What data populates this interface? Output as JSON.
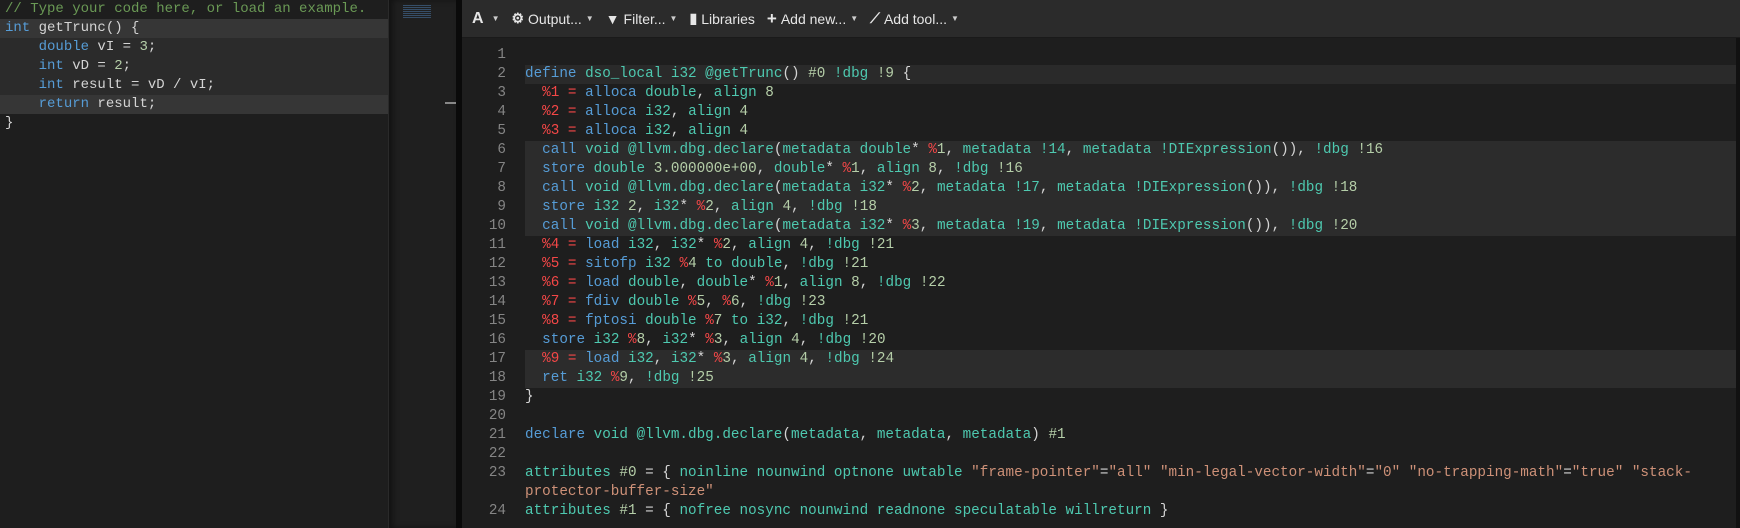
{
  "source": {
    "lines": [
      [
        [
          "c",
          "// Type your code here, or load an example."
        ]
      ],
      [
        [
          "k",
          "int"
        ],
        [
          "p",
          " getTrunc() {"
        ]
      ],
      [
        [
          "p",
          "    "
        ],
        [
          "k",
          "double"
        ],
        [
          "p",
          " vI = "
        ],
        [
          "n",
          "3"
        ],
        [
          "p",
          ";"
        ]
      ],
      [
        [
          "p",
          "    "
        ],
        [
          "k",
          "int"
        ],
        [
          "p",
          " vD = "
        ],
        [
          "n",
          "2"
        ],
        [
          "p",
          ";"
        ]
      ],
      [
        [
          "p",
          "    "
        ],
        [
          "k",
          "int"
        ],
        [
          "p",
          " result = vD / vI;"
        ]
      ],
      [
        [
          "p",
          "    "
        ],
        [
          "k",
          "return"
        ],
        [
          "p",
          " result;"
        ]
      ],
      [
        [
          "p",
          "}"
        ]
      ]
    ]
  },
  "toolbar": {
    "font_label": "A",
    "output": "Output...",
    "filter": "Filter...",
    "libraries": "Libraries",
    "add_new": "Add new...",
    "add_tool": "Add tool..."
  },
  "output": {
    "lines": [
      [],
      [
        [
          "k",
          "define"
        ],
        [
          "t",
          " dso_local i32 @getTrunc"
        ],
        [
          "p",
          "() "
        ],
        [
          "n",
          "#0"
        ],
        [
          "t",
          " !dbg"
        ],
        [
          "n",
          " !9"
        ],
        [
          "p",
          " {"
        ]
      ],
      [
        [
          "r",
          "  %1 ="
        ],
        [
          "k",
          " alloca"
        ],
        [
          "t",
          " double"
        ],
        [
          "p",
          ", "
        ],
        [
          "t",
          "align"
        ],
        [
          "n",
          " 8"
        ]
      ],
      [
        [
          "r",
          "  %2 ="
        ],
        [
          "k",
          " alloca"
        ],
        [
          "t",
          " i32"
        ],
        [
          "p",
          ", "
        ],
        [
          "t",
          "align"
        ],
        [
          "n",
          " 4"
        ]
      ],
      [
        [
          "r",
          "  %3 ="
        ],
        [
          "k",
          " alloca"
        ],
        [
          "t",
          " i32"
        ],
        [
          "p",
          ", "
        ],
        [
          "t",
          "align"
        ],
        [
          "n",
          " 4"
        ]
      ],
      [
        [
          "p",
          "  "
        ],
        [
          "k",
          "call"
        ],
        [
          "t",
          " void @llvm.dbg.declare"
        ],
        [
          "p",
          "("
        ],
        [
          "t",
          "metadata double"
        ],
        [
          "p",
          "* "
        ],
        [
          "r",
          "%"
        ],
        [
          "n",
          "1"
        ],
        [
          "p",
          ", "
        ],
        [
          "t",
          "metadata !14"
        ],
        [
          "p",
          ", "
        ],
        [
          "t",
          "metadata !DIExpression"
        ],
        [
          "p",
          "()), "
        ],
        [
          "t",
          "!dbg"
        ],
        [
          "n",
          " !16"
        ]
      ],
      [
        [
          "p",
          "  "
        ],
        [
          "k",
          "store"
        ],
        [
          "t",
          " double"
        ],
        [
          "n",
          " 3.000000e+00"
        ],
        [
          "p",
          ", "
        ],
        [
          "t",
          "double"
        ],
        [
          "p",
          "* "
        ],
        [
          "r",
          "%"
        ],
        [
          "n",
          "1"
        ],
        [
          "p",
          ", "
        ],
        [
          "t",
          "align"
        ],
        [
          "n",
          " 8"
        ],
        [
          "p",
          ", "
        ],
        [
          "t",
          "!dbg"
        ],
        [
          "n",
          " !16"
        ]
      ],
      [
        [
          "p",
          "  "
        ],
        [
          "k",
          "call"
        ],
        [
          "t",
          " void @llvm.dbg.declare"
        ],
        [
          "p",
          "("
        ],
        [
          "t",
          "metadata i32"
        ],
        [
          "p",
          "* "
        ],
        [
          "r",
          "%"
        ],
        [
          "n",
          "2"
        ],
        [
          "p",
          ", "
        ],
        [
          "t",
          "metadata !17"
        ],
        [
          "p",
          ", "
        ],
        [
          "t",
          "metadata !DIExpression"
        ],
        [
          "p",
          "()), "
        ],
        [
          "t",
          "!dbg"
        ],
        [
          "n",
          " !18"
        ]
      ],
      [
        [
          "p",
          "  "
        ],
        [
          "k",
          "store"
        ],
        [
          "t",
          " i32"
        ],
        [
          "n",
          " 2"
        ],
        [
          "p",
          ", "
        ],
        [
          "t",
          "i32"
        ],
        [
          "p",
          "* "
        ],
        [
          "r",
          "%"
        ],
        [
          "n",
          "2"
        ],
        [
          "p",
          ", "
        ],
        [
          "t",
          "align"
        ],
        [
          "n",
          " 4"
        ],
        [
          "p",
          ", "
        ],
        [
          "t",
          "!dbg"
        ],
        [
          "n",
          " !18"
        ]
      ],
      [
        [
          "p",
          "  "
        ],
        [
          "k",
          "call"
        ],
        [
          "t",
          " void @llvm.dbg.declare"
        ],
        [
          "p",
          "("
        ],
        [
          "t",
          "metadata i32"
        ],
        [
          "p",
          "* "
        ],
        [
          "r",
          "%"
        ],
        [
          "n",
          "3"
        ],
        [
          "p",
          ", "
        ],
        [
          "t",
          "metadata !19"
        ],
        [
          "p",
          ", "
        ],
        [
          "t",
          "metadata !DIExpression"
        ],
        [
          "p",
          "()), "
        ],
        [
          "t",
          "!dbg"
        ],
        [
          "n",
          " !20"
        ]
      ],
      [
        [
          "r",
          "  %4 ="
        ],
        [
          "k",
          " load"
        ],
        [
          "t",
          " i32"
        ],
        [
          "p",
          ", "
        ],
        [
          "t",
          "i32"
        ],
        [
          "p",
          "* "
        ],
        [
          "r",
          "%"
        ],
        [
          "n",
          "2"
        ],
        [
          "p",
          ", "
        ],
        [
          "t",
          "align"
        ],
        [
          "n",
          " 4"
        ],
        [
          "p",
          ", "
        ],
        [
          "t",
          "!dbg"
        ],
        [
          "n",
          " !21"
        ]
      ],
      [
        [
          "r",
          "  %5 ="
        ],
        [
          "k",
          " sitofp"
        ],
        [
          "t",
          " i32"
        ],
        [
          "r",
          " %"
        ],
        [
          "n",
          "4"
        ],
        [
          "t",
          " to double"
        ],
        [
          "p",
          ", "
        ],
        [
          "t",
          "!dbg"
        ],
        [
          "n",
          " !21"
        ]
      ],
      [
        [
          "r",
          "  %6 ="
        ],
        [
          "k",
          " load"
        ],
        [
          "t",
          " double"
        ],
        [
          "p",
          ", "
        ],
        [
          "t",
          "double"
        ],
        [
          "p",
          "* "
        ],
        [
          "r",
          "%"
        ],
        [
          "n",
          "1"
        ],
        [
          "p",
          ", "
        ],
        [
          "t",
          "align"
        ],
        [
          "n",
          " 8"
        ],
        [
          "p",
          ", "
        ],
        [
          "t",
          "!dbg"
        ],
        [
          "n",
          " !22"
        ]
      ],
      [
        [
          "r",
          "  %7 ="
        ],
        [
          "k",
          " fdiv"
        ],
        [
          "t",
          " double"
        ],
        [
          "r",
          " %"
        ],
        [
          "n",
          "5"
        ],
        [
          "p",
          ", "
        ],
        [
          "r",
          "%"
        ],
        [
          "n",
          "6"
        ],
        [
          "p",
          ", "
        ],
        [
          "t",
          "!dbg"
        ],
        [
          "n",
          " !23"
        ]
      ],
      [
        [
          "r",
          "  %8 ="
        ],
        [
          "k",
          " fptosi"
        ],
        [
          "t",
          " double"
        ],
        [
          "r",
          " %"
        ],
        [
          "n",
          "7"
        ],
        [
          "t",
          " to i32"
        ],
        [
          "p",
          ", "
        ],
        [
          "t",
          "!dbg"
        ],
        [
          "n",
          " !21"
        ]
      ],
      [
        [
          "p",
          "  "
        ],
        [
          "k",
          "store"
        ],
        [
          "t",
          " i32"
        ],
        [
          "r",
          " %"
        ],
        [
          "n",
          "8"
        ],
        [
          "p",
          ", "
        ],
        [
          "t",
          "i32"
        ],
        [
          "p",
          "* "
        ],
        [
          "r",
          "%"
        ],
        [
          "n",
          "3"
        ],
        [
          "p",
          ", "
        ],
        [
          "t",
          "align"
        ],
        [
          "n",
          " 4"
        ],
        [
          "p",
          ", "
        ],
        [
          "t",
          "!dbg"
        ],
        [
          "n",
          " !20"
        ]
      ],
      [
        [
          "r",
          "  %9 ="
        ],
        [
          "k",
          " load"
        ],
        [
          "t",
          " i32"
        ],
        [
          "p",
          ", "
        ],
        [
          "t",
          "i32"
        ],
        [
          "p",
          "* "
        ],
        [
          "r",
          "%"
        ],
        [
          "n",
          "3"
        ],
        [
          "p",
          ", "
        ],
        [
          "t",
          "align"
        ],
        [
          "n",
          " 4"
        ],
        [
          "p",
          ", "
        ],
        [
          "t",
          "!dbg"
        ],
        [
          "n",
          " !24"
        ]
      ],
      [
        [
          "p",
          "  "
        ],
        [
          "k",
          "ret"
        ],
        [
          "t",
          " i32"
        ],
        [
          "r",
          " %"
        ],
        [
          "n",
          "9"
        ],
        [
          "p",
          ", "
        ],
        [
          "t",
          "!dbg"
        ],
        [
          "n",
          " !25"
        ]
      ],
      [
        [
          "p",
          "}"
        ]
      ],
      [],
      [
        [
          "k",
          "declare"
        ],
        [
          "t",
          " void @llvm.dbg.declare"
        ],
        [
          "p",
          "("
        ],
        [
          "t",
          "metadata"
        ],
        [
          "p",
          ", "
        ],
        [
          "t",
          "metadata"
        ],
        [
          "p",
          ", "
        ],
        [
          "t",
          "metadata"
        ],
        [
          "p",
          ") "
        ],
        [
          "n",
          "#1"
        ]
      ],
      [],
      [
        [
          "t",
          "attributes"
        ],
        [
          "n",
          " #0"
        ],
        [
          "p",
          " = { "
        ],
        [
          "t",
          "noinline nounwind optnone uwtable "
        ],
        [
          "s",
          "\"frame-pointer\""
        ],
        [
          "p",
          "="
        ],
        [
          "s",
          "\"all\" \"min-legal-vector-width\""
        ],
        [
          "p",
          "="
        ],
        [
          "s",
          "\"0\" \"no-trapping-math\""
        ],
        [
          "p",
          "="
        ],
        [
          "s",
          "\"true\" \"stack-protector-buffer-size\""
        ]
      ],
      [
        [
          "t",
          "attributes"
        ],
        [
          "n",
          " #1"
        ],
        [
          "p",
          " = { "
        ],
        [
          "t",
          "nofree nosync nounwind readnone speculatable willreturn"
        ],
        [
          "p",
          " }"
        ]
      ]
    ]
  }
}
